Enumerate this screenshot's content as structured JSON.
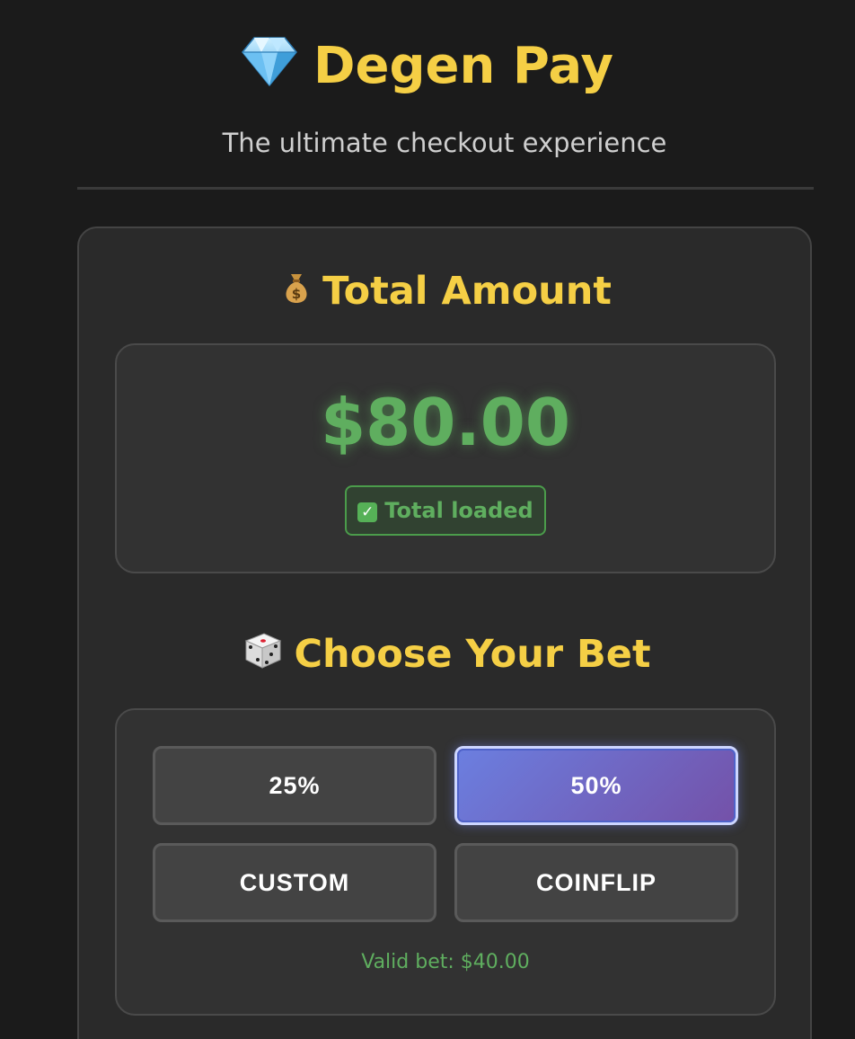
{
  "header": {
    "title": "Degen Pay",
    "title_icon": "diamond-icon",
    "subtitle": "The ultimate checkout experience"
  },
  "total_section": {
    "heading": "Total Amount",
    "heading_icon": "money-bag-icon",
    "amount": "$80.00",
    "status_text": "Total loaded",
    "status_icon": "checkmark-icon"
  },
  "bet_section": {
    "heading": "Choose Your Bet",
    "heading_icon": "dice-icon",
    "options": [
      {
        "label": "25%",
        "selected": false
      },
      {
        "label": "50%",
        "selected": true
      },
      {
        "label": "CUSTOM",
        "selected": false
      },
      {
        "label": "COINFLIP",
        "selected": false
      }
    ],
    "valid_bet_text": "Valid bet: $40.00"
  },
  "colors": {
    "accent_yellow": "#f5cf45",
    "success_green": "#5fae5f",
    "selected_gradient_start": "#6b7fe0",
    "selected_gradient_end": "#7451a8",
    "background": "#1b1b1b"
  }
}
